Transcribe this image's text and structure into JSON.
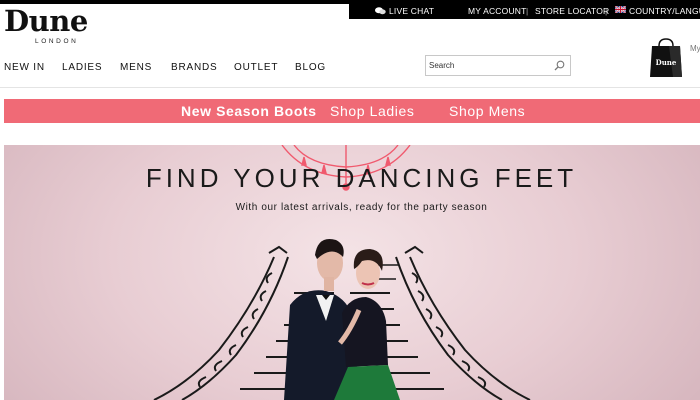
{
  "utility_bar": {
    "live_chat": "LIVE CHAT",
    "my_account": "MY ACCOUNT",
    "separator": "|",
    "store_locator": "STORE LOCATOR",
    "country_language": "COUNTRY/LANGUA"
  },
  "brand": {
    "name": "Dune",
    "sub": "LONDON"
  },
  "nav": {
    "items": [
      "NEW IN",
      "LADIES",
      "MENS",
      "BRANDS",
      "OUTLET",
      "BLOG"
    ]
  },
  "search": {
    "placeholder": "Search",
    "value": ""
  },
  "bag": {
    "brand_on_bag": "Dune",
    "label": "My"
  },
  "promo": {
    "headline": "New Season Boots",
    "link_ladies": "Shop Ladies",
    "link_mens": "Shop Mens"
  },
  "hero": {
    "title": "FIND YOUR DANCING FEET",
    "subtitle": "With our latest arrivals, ready for the party season"
  },
  "colors": {
    "promo_bar": "#f06a76",
    "top_bar": "#000000",
    "hero_background": "#ecd3d8",
    "chandelier": "#f05a6e"
  },
  "icons": [
    "chat-icon",
    "uk-flag-icon",
    "search-icon",
    "shopping-bag-icon"
  ]
}
